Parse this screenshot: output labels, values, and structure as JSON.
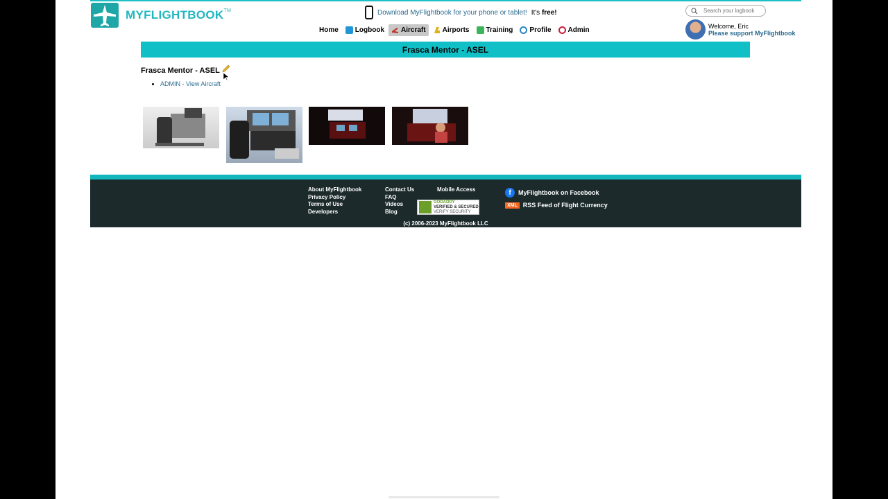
{
  "header": {
    "logo_text": "MYFLIGHTBOOK",
    "logo_tm": "TM",
    "promo_link": "Download MyFlightbook for your phone or tablet!",
    "promo_suffix_a": " It's ",
    "promo_suffix_b": "free!",
    "search_placeholder": "Search your logbook",
    "welcome": "Welcome, Eric",
    "support_link": "Please support MyFlightbook"
  },
  "nav": {
    "items": [
      {
        "label": "Home",
        "icon": "home"
      },
      {
        "label": "Logbook",
        "icon": "logbook-icon"
      },
      {
        "label": "Aircraft",
        "icon": "aircraft-icon",
        "active": true
      },
      {
        "label": "Airports",
        "icon": "airport-icon"
      },
      {
        "label": "Training",
        "icon": "training-icon"
      },
      {
        "label": "Profile",
        "icon": "profile-icon"
      },
      {
        "label": "Admin",
        "icon": "admin-icon"
      }
    ]
  },
  "main": {
    "title": "Frasca Mentor - ASEL",
    "aircraft_name": "Frasca Mentor - ASEL",
    "admin_link": "ADMIN - View Aircraft"
  },
  "footer": {
    "col1": [
      "About MyFlightbook",
      "Privacy Policy",
      "Terms of Use",
      "Developers"
    ],
    "col2": [
      "Contact Us",
      "FAQ",
      "Videos",
      "Blog"
    ],
    "col3": [
      "Mobile Access"
    ],
    "godaddy_line1": "GODADDY",
    "godaddy_line2": "VERIFIED & SECURED",
    "godaddy_line3": "VERIFY SECURITY",
    "facebook": "MyFlightbook on Facebook",
    "xml_badge": "XML",
    "rss": "RSS Feed of Flight Currency",
    "copyright": "(c) 2006-2023 MyFlightbook LLC"
  },
  "colors": {
    "accent": "#11c0c7",
    "link": "#2b6a8f",
    "footer_bg": "#1c2a2c"
  }
}
